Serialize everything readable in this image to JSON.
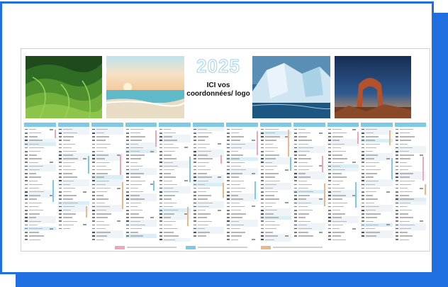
{
  "calendar": {
    "year": "2025",
    "contact_placeholder": "ICI vos coordonnées/ logo",
    "colors": {
      "frame": "#1f6fe0",
      "month_header": "#7ec9e4",
      "zone_a": "#e9a9b8",
      "zone_b": "#7ec9e4",
      "zone_c": "#e8b98d"
    },
    "photos": [
      "green-hills-photo",
      "beach-sunset-photo",
      "glacier-photo",
      "rock-arch-photo"
    ],
    "month_count": 12
  }
}
